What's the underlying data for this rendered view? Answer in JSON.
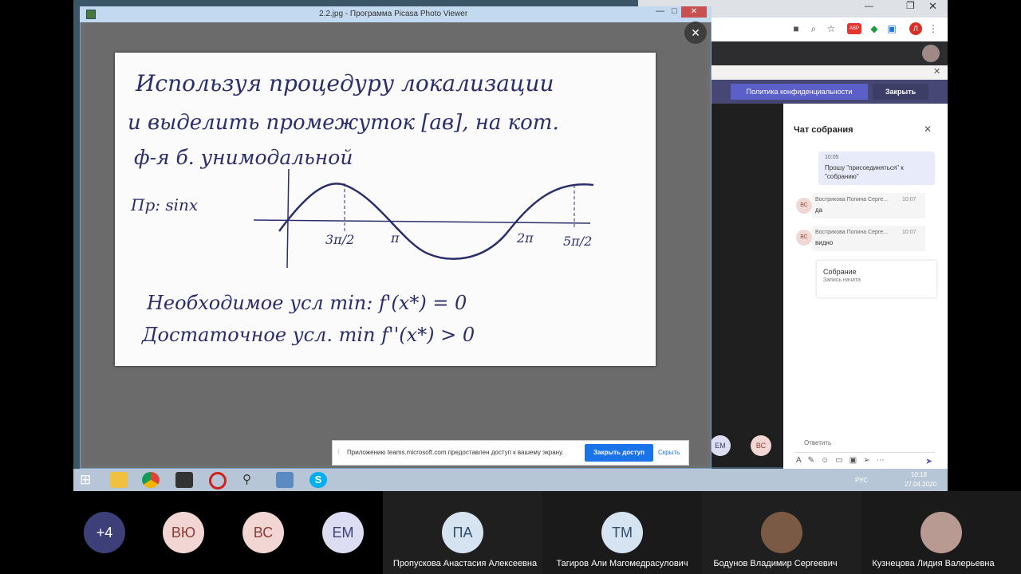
{
  "picasa": {
    "title": "2.2.jpg - Программа Picasa Photo Viewer"
  },
  "photo": {
    "line1": "Используя процедуру локализации",
    "line2": "и выделить промежуток [ав], на кот.",
    "line3": "ф-я б. унимодальной",
    "example": "Пр: sinx",
    "tick1": "3π/2",
    "tick2": "π",
    "tick3": "2π",
    "tick4": "5π/2",
    "cond1": "Необходимое усл min: f'(x*) = 0",
    "cond2": "Достаточное усл. min f''(x*) > 0"
  },
  "share": {
    "message": "Приложению teams.microsoft.com предоставлен доступ к вашему экрану.",
    "stop_label": "Закрыть доступ",
    "hide_label": "Скрыть"
  },
  "teams": {
    "privacy_label": "Политика конфиденциальности",
    "close_label": "Закрыть",
    "chat_title": "Чат собрания",
    "messages": [
      {
        "time": "10:05",
        "text": "Прошу \"присоединяться\" к \"собранию\""
      },
      {
        "initials": "ВС",
        "author": "Вострикова Полина Серге...",
        "time": "10:07",
        "text": "да"
      },
      {
        "initials": "ВС",
        "author": "Вострикова Полина Серге...",
        "time": "10:07",
        "text": "видно"
      }
    ],
    "meeting_title": "Собрание",
    "meeting_sub": "Запись начата",
    "reply_placeholder": "Ответить",
    "side_avatars": [
      "ЕМ",
      "ВС"
    ]
  },
  "taskbar": {
    "lang": "РУС",
    "time": "10:18",
    "date": "27.04.2020"
  },
  "gallery": [
    {
      "initials": "+4",
      "bg": "#3d3f78",
      "fg": "#ffffff",
      "name": ""
    },
    {
      "initials": "ВЮ",
      "bg": "#f2d6d3",
      "fg": "#8a3d37",
      "name": ""
    },
    {
      "initials": "ВС",
      "bg": "#f2d6d3",
      "fg": "#8a3d37",
      "name": ""
    },
    {
      "initials": "ЕМ",
      "bg": "#dcdcf2",
      "fg": "#3d3f78",
      "name": ""
    },
    {
      "initials": "ПА",
      "bg": "#d6e3f0",
      "fg": "#2f4d6e",
      "name": "Пропускова Анастасия Алексеевна"
    },
    {
      "initials": "ТМ",
      "bg": "#d6e3f0",
      "fg": "#2f4d6e",
      "name": "Тагиров Али Магомедрасулович"
    },
    {
      "initials": "",
      "bg": "#7a5a44",
      "fg": "#ffffff",
      "name": "Бодунов Владимир Сергеевич"
    },
    {
      "initials": "",
      "bg": "#b99a92",
      "fg": "#ffffff",
      "name": "Кузнецова Лидия Валерьевна"
    }
  ]
}
